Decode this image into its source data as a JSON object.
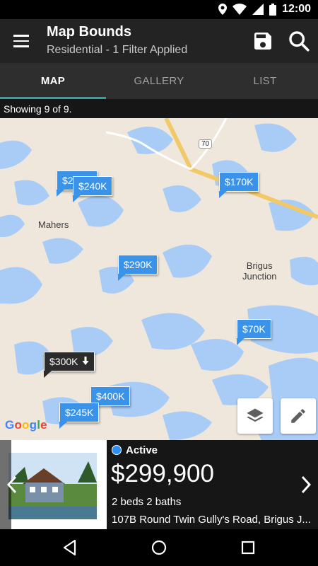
{
  "status_bar": {
    "time": "12:00"
  },
  "app_bar": {
    "title": "Map Bounds",
    "subtitle": "Residential - 1 Filter Applied"
  },
  "tabs": [
    {
      "label": "MAP",
      "active": true
    },
    {
      "label": "GALLERY",
      "active": false
    },
    {
      "label": "LIST",
      "active": false
    }
  ],
  "results": {
    "showing_text": "Showing 9 of 9."
  },
  "map": {
    "places": {
      "mahers": "Mahers",
      "brigus_line1": "Brigus",
      "brigus_line2": "Junction",
      "route": "70"
    },
    "pins": [
      {
        "label": "$2"
      },
      {
        "label": "$240K"
      },
      {
        "label": "$170K"
      },
      {
        "label": "$290K"
      },
      {
        "label": "$70K"
      },
      {
        "label": "$300K"
      },
      {
        "label": "$400K"
      },
      {
        "label": "$245K"
      }
    ],
    "attribution": "Google"
  },
  "listing": {
    "status": "Active",
    "price": "$299,900",
    "beds_baths": "2 beds 2 baths",
    "address": "107B Round Twin Gully's Road, Brigus J..."
  },
  "colors": {
    "accent": "#2aa7a0",
    "pin": "#3a93e8",
    "water": "#a9ccf7",
    "land": "#efe7dc",
    "highway": "#f2c968"
  }
}
